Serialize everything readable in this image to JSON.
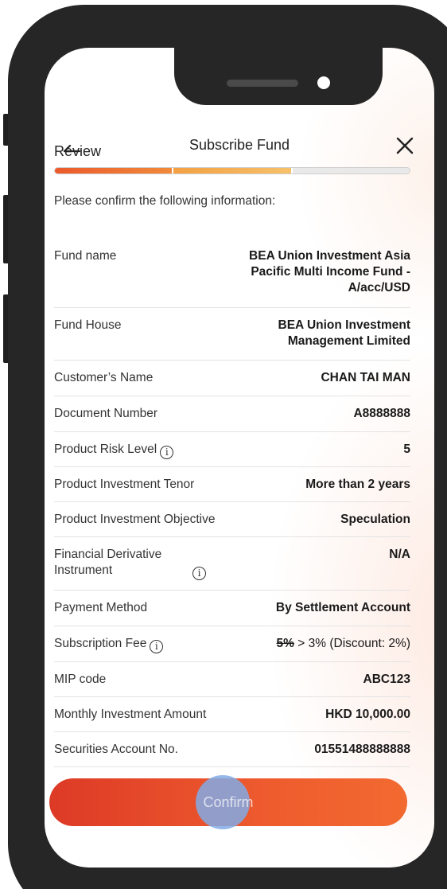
{
  "header": {
    "title": "Subscribe Fund"
  },
  "step": {
    "label": "Review",
    "current": 2,
    "total": 3
  },
  "intro": "Please confirm the following information:",
  "rows": [
    {
      "label": "Fund name",
      "value": "BEA Union Investment Asia Pacific Multi Income Fund - A/acc/USD"
    },
    {
      "label": "Fund House",
      "value": "BEA Union Investment Management Limited"
    },
    {
      "label": "Customer’s Name",
      "value": "CHAN TAI MAN"
    },
    {
      "label": "Document Number",
      "value": "A8888888"
    },
    {
      "label": "Product Risk Level",
      "value": "5"
    },
    {
      "label": "Product Investment Tenor",
      "value": "More than 2 years"
    },
    {
      "label": "Product Investment Objective",
      "value": "Speculation"
    },
    {
      "label": "Financial Derivative Instrument",
      "value": "N/A"
    },
    {
      "label": "Payment Method",
      "value": "By Settlement Account"
    },
    {
      "label": "Subscription Fee",
      "value_old": "5%",
      "value_arrow": ">",
      "value_new": "3% (Discount: 2%)"
    },
    {
      "label": "MIP code",
      "value": "ABC123"
    },
    {
      "label": "Monthly Investment Amount",
      "value": "HKD 10,000.00"
    },
    {
      "label": "Securities Account No.",
      "value": "01551488888888"
    }
  ],
  "info_icon_glyph": "i",
  "confirm_label": "Confirm",
  "colors": {
    "accent": "#ec5a2c",
    "button_start": "#dd3a26",
    "button_end": "#f26a30"
  }
}
